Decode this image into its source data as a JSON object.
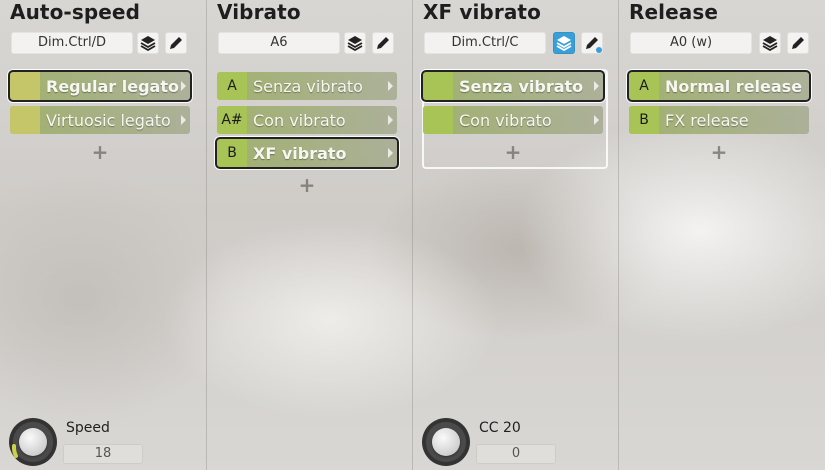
{
  "columns": [
    {
      "title": "Auto-speed",
      "controller": "Dim.Ctrl/D",
      "articulations": [
        {
          "key": "",
          "label": "Regular legato",
          "selected": true
        },
        {
          "key": "",
          "label": "Virtuosic legato",
          "selected": false
        }
      ],
      "add_label": "+",
      "knob": {
        "label": "Speed",
        "value": "18"
      }
    },
    {
      "title": "Vibrato",
      "controller": "A6",
      "articulations": [
        {
          "key": "A",
          "label": "Senza vibrato",
          "selected": false
        },
        {
          "key": "A#",
          "label": "Con vibrato",
          "selected": false
        },
        {
          "key": "B",
          "label": "XF vibrato",
          "selected": true
        }
      ],
      "add_label": "+"
    },
    {
      "title": "XF vibrato",
      "controller": "Dim.Ctrl/C",
      "layers_active": true,
      "articulations": [
        {
          "key": "",
          "label": "Senza vibrato",
          "selected": true
        },
        {
          "key": "",
          "label": "Con vibrato",
          "selected": false
        }
      ],
      "add_label": "+",
      "knob": {
        "label": "CC 20",
        "value": "0"
      }
    },
    {
      "title": "Release",
      "controller": "A0 (w)",
      "articulations": [
        {
          "key": "A",
          "label": "Normal release",
          "selected": true
        },
        {
          "key": "B",
          "label": "FX release",
          "selected": false
        }
      ],
      "add_label": "+"
    }
  ],
  "icons": {
    "layers": "layers-icon",
    "edit": "pencil-icon",
    "next": "chevron-right-icon"
  },
  "colors": {
    "articulation_green": "#a9c456",
    "articulation_yellow": "#c5c56a",
    "active_blue": "#3a9fd8"
  }
}
